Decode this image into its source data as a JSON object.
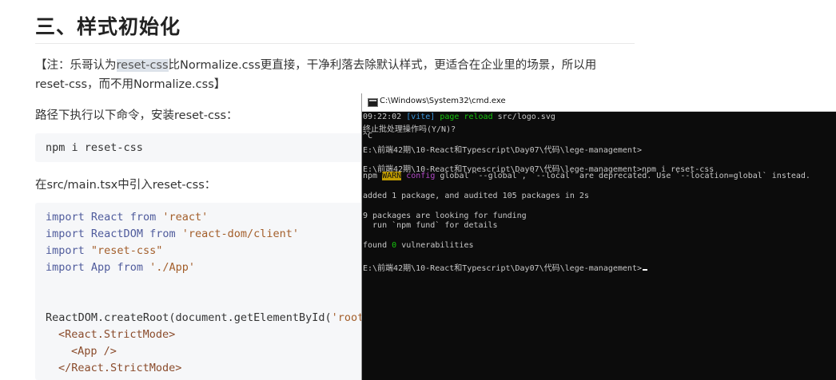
{
  "article": {
    "heading": "三、样式初始化",
    "note_line1_pre": "【注：乐哥认为",
    "note_highlight": "reset-css",
    "note_line1_post": "比Normalize.css更直接，干净利落去除默认样式，更适合在企业里的场景，所以用",
    "note_line2": "reset-css，而不用Normalize.css】",
    "para1": "路径下执行以下命令，安装reset-css：",
    "cmd_install": "npm i reset-css",
    "para2": "在src/main.tsx中引入reset-css：",
    "code": {
      "l1_kw": "import",
      "l1_id": "React",
      "l1_from": "from",
      "l1_str": "'react'",
      "l2_kw": "import",
      "l2_id": "ReactDOM",
      "l2_from": "from",
      "l2_str": "'react-dom/client'",
      "l3_kw": "import",
      "l3_str": "\"reset-css\"",
      "l4_kw": "import",
      "l4_id": "App",
      "l4_from": "from",
      "l4_str": "'./App'",
      "l5": "ReactDOM.createRoot(document.getElementById(",
      "l5_str": "'root",
      "l6": "<React.StrictMode>",
      "l7": "<App />",
      "l8": "</React.StrictMode>"
    }
  },
  "terminal": {
    "title": "C:\\Windows\\System32\\cmd.exe",
    "l1_time": "09:22:02",
    "l1_tag": "[vite]",
    "l1_msg": "page reload",
    "l1_file": "src/logo.svg",
    "l2": "终止批处理操作吗(Y/N)?",
    "l3": "^C",
    "l4": "E:\\前端42期\\10-React和Typescript\\Day07\\代码\\lege-management>",
    "l5": "E:\\前端42期\\10-React和Typescript\\Day07\\代码\\lege-management>npm i reset-css",
    "l6_npm": "npm",
    "l6_warn": "WARN",
    "l6_config": "config",
    "l6_msg": "global `--global`, `--local` are deprecated. Use `--location=global` instead.",
    "l7": "added 1 package, and audited 105 packages in 2s",
    "l8": "9 packages are looking for funding",
    "l9": "  run `npm fund` for details",
    "l10_pre": "found",
    "l10_num": "0",
    "l10_post": "vulnerabilities",
    "l11": "E:\\前端42期\\10-React和Typescript\\Day07\\代码\\lege-management>"
  },
  "colors": {
    "terminal_bg": "#0c0c0c",
    "terminal_text": "#c8c8c8",
    "vite_cyan": "#3a96dd",
    "success_green": "#16c60c",
    "warn_bg": "#c19c00",
    "config_magenta": "#b148c6",
    "code_bg": "#f6f7f9",
    "highlight_bg": "#dde3ea"
  }
}
